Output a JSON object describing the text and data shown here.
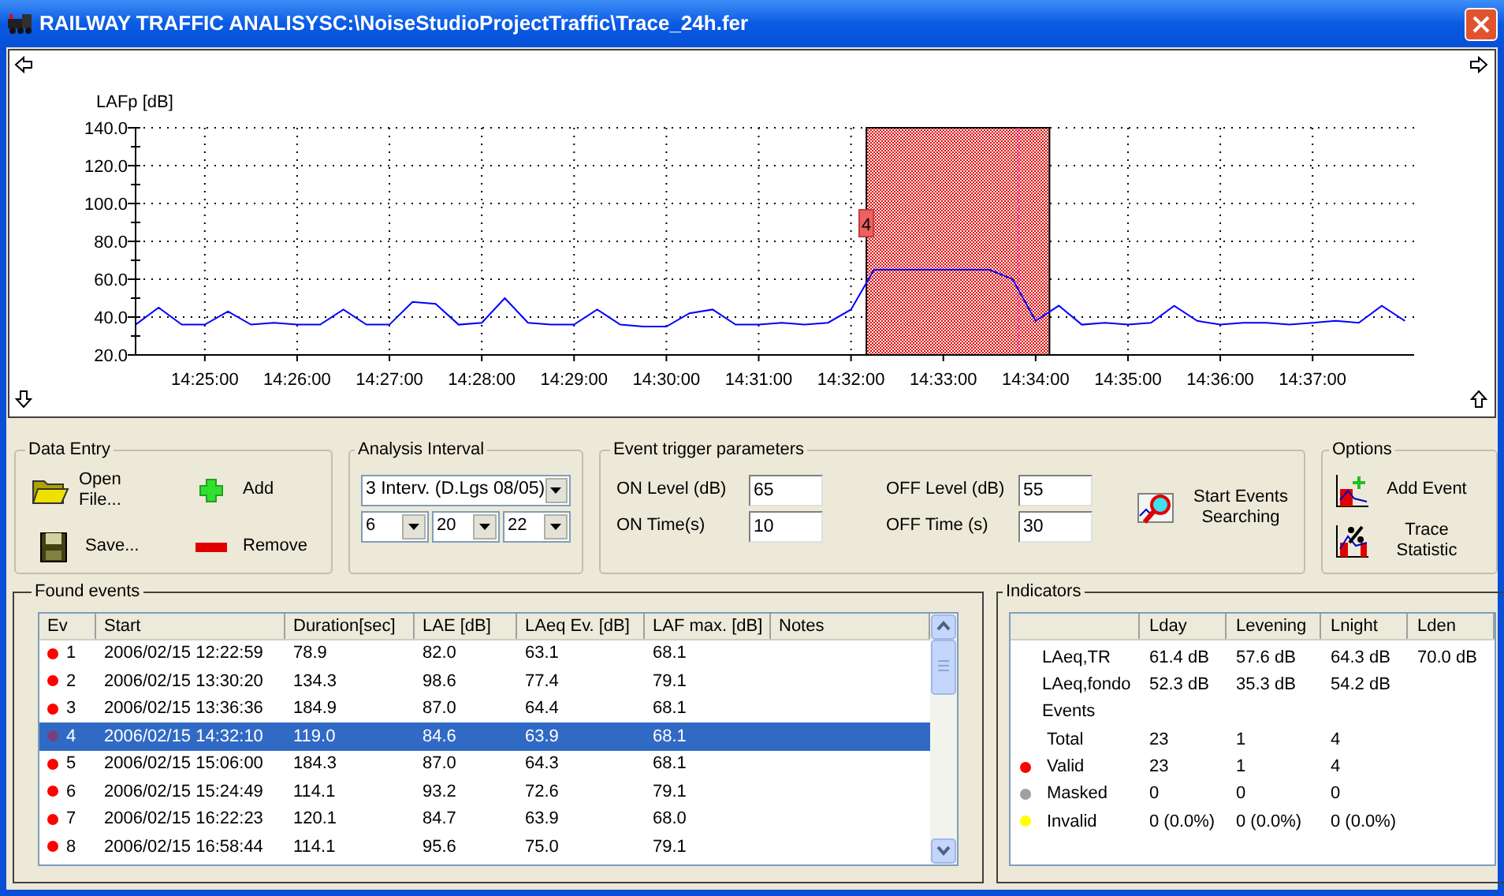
{
  "window": {
    "title": "RAILWAY TRAFFIC ANALISYSC:\\NoiseStudioProjectTraffic\\Trace_24h.fer"
  },
  "trace_plot": {
    "event_marker": "4",
    "chart_data": {
      "type": "line",
      "ylabel": "LAFp [dB]",
      "categories": [
        null,
        null,
        null,
        "14:25:00",
        null,
        null,
        null,
        "14:26:00",
        null,
        null,
        null,
        "14:27:00",
        null,
        null,
        null,
        "14:28:00",
        null,
        null,
        null,
        "14:29:00",
        null,
        null,
        null,
        "14:30:00",
        null,
        null,
        null,
        "14:31:00",
        null,
        null,
        null,
        "14:32:00",
        null,
        null,
        null,
        "14:33:00",
        null,
        null,
        null,
        "14:34:00",
        null,
        null,
        null,
        "14:35:00",
        null,
        null,
        null,
        "14:36:00",
        null,
        null,
        null,
        "14:37:00",
        null,
        null,
        null,
        null
      ],
      "series": [
        {
          "color": "#0000ff",
          "values": [
            36,
            45,
            36,
            36,
            43,
            36,
            37,
            36,
            36,
            44,
            36,
            36,
            48,
            47,
            36,
            37,
            50,
            37,
            36,
            36,
            44,
            36,
            35,
            35,
            42,
            44,
            36,
            36,
            37,
            36,
            37,
            44,
            65,
            65,
            65,
            65,
            65,
            65,
            60,
            38,
            46,
            36,
            37,
            36,
            37,
            46,
            38,
            36,
            37,
            37,
            36,
            37,
            38,
            37,
            46,
            38
          ]
        }
      ],
      "ylim": [
        20,
        140
      ],
      "grid": true,
      "yticks": [
        {
          "value": 140,
          "label": "140.0"
        },
        {
          "value": 120,
          "label": "120.0"
        },
        {
          "value": 100,
          "label": "100.0"
        },
        {
          "value": 80,
          "label": "80.0"
        },
        {
          "value": 60,
          "label": "60.0"
        },
        {
          "value": 40,
          "label": "40.0"
        },
        {
          "value": 20,
          "label": "20.0"
        }
      ]
    }
  },
  "data_entry": {
    "title": "Data Entry",
    "buttons": [
      {
        "kind": "open",
        "label": "Open File..."
      },
      {
        "kind": "add",
        "label": "Add"
      },
      {
        "kind": "save",
        "label": "Save..."
      },
      {
        "kind": "remove",
        "label": "Remove"
      }
    ]
  },
  "analysis_interval": {
    "title": "Analysis Interval",
    "preset": "3 Interv. (D.Lgs 08/05)",
    "hours": [
      "6",
      "20",
      "22"
    ]
  },
  "event_trigger": {
    "title": "Event trigger parameters",
    "fields": [
      {
        "label": "ON Level (dB)",
        "value": "65"
      },
      {
        "label": "ON Time(s)",
        "value": "10"
      },
      {
        "label": "OFF Level (dB)",
        "value": "55"
      },
      {
        "label": "OFF Time (s)",
        "value": "30"
      }
    ],
    "search_button": "Start Events Searching"
  },
  "options": {
    "title": "Options",
    "buttons": [
      {
        "kind": "add_event",
        "label": "Add Event"
      },
      {
        "kind": "statistic",
        "label": "Trace Statistic"
      }
    ]
  },
  "found_events": {
    "title": "Found events",
    "columns": [
      "Ev",
      "Start",
      "Duration[sec]",
      "LAE [dB]",
      "LAeq Ev. [dB]",
      "LAF max. [dB]",
      "Notes"
    ],
    "rows": [
      {
        "ev": "1",
        "start": "2006/02/15 12:22:59",
        "duration": "78.9",
        "lae": "82.0",
        "laeq": "63.1",
        "lafmax": "68.1",
        "color": "#ff0000",
        "selected": false
      },
      {
        "ev": "2",
        "start": "2006/02/15 13:30:20",
        "duration": "134.3",
        "lae": "98.6",
        "laeq": "77.4",
        "lafmax": "79.1",
        "color": "#ff0000",
        "selected": false
      },
      {
        "ev": "3",
        "start": "2006/02/15 13:36:36",
        "duration": "184.9",
        "lae": "87.0",
        "laeq": "64.4",
        "lafmax": "68.1",
        "color": "#ff0000",
        "selected": false
      },
      {
        "ev": "4",
        "start": "2006/02/15 14:32:10",
        "duration": "119.0",
        "lae": "84.6",
        "laeq": "63.9",
        "lafmax": "68.1",
        "color": "#7b3f7b",
        "selected": true
      },
      {
        "ev": "5",
        "start": "2006/02/15 15:06:00",
        "duration": "184.3",
        "lae": "87.0",
        "laeq": "64.3",
        "lafmax": "68.1",
        "color": "#ff0000",
        "selected": false
      },
      {
        "ev": "6",
        "start": "2006/02/15 15:24:49",
        "duration": "114.1",
        "lae": "93.2",
        "laeq": "72.6",
        "lafmax": "79.1",
        "color": "#ff0000",
        "selected": false
      },
      {
        "ev": "7",
        "start": "2006/02/15 16:22:23",
        "duration": "120.1",
        "lae": "84.7",
        "laeq": "63.9",
        "lafmax": "68.0",
        "color": "#ff0000",
        "selected": false
      },
      {
        "ev": "8",
        "start": "2006/02/15 16:58:44",
        "duration": "114.1",
        "lae": "95.6",
        "laeq": "75.0",
        "lafmax": "79.1",
        "color": "#ff0000",
        "selected": false
      }
    ]
  },
  "indicators": {
    "title": "Indicators",
    "columns": [
      "Lday",
      "Levening",
      "Lnight",
      "Lden"
    ],
    "rows": [
      {
        "kind": "measure",
        "label": "LAeq,TR",
        "values": [
          "61.4 dB",
          "57.6 dB",
          "64.3 dB",
          "70.0 dB"
        ]
      },
      {
        "kind": "measure",
        "label": "LAeq,fondo",
        "values": [
          "52.3 dB",
          "35.3 dB",
          "54.2 dB"
        ]
      },
      {
        "kind": "heading",
        "label": "Events"
      },
      {
        "kind": "count",
        "label": "Total",
        "values": [
          "23",
          "1",
          "4"
        ]
      },
      {
        "kind": "count",
        "label": "Valid",
        "color": "#ff0000",
        "values": [
          "23",
          "1",
          "4"
        ]
      },
      {
        "kind": "count",
        "label": "Masked",
        "color": "#a0a0a0",
        "values": [
          "0",
          "0",
          "0"
        ]
      },
      {
        "kind": "count",
        "label": "Invalid",
        "color": "#ffff00",
        "values": [
          "0 (0.0%)",
          "0 (0.0%)",
          "0 (0.0%)"
        ]
      }
    ]
  }
}
